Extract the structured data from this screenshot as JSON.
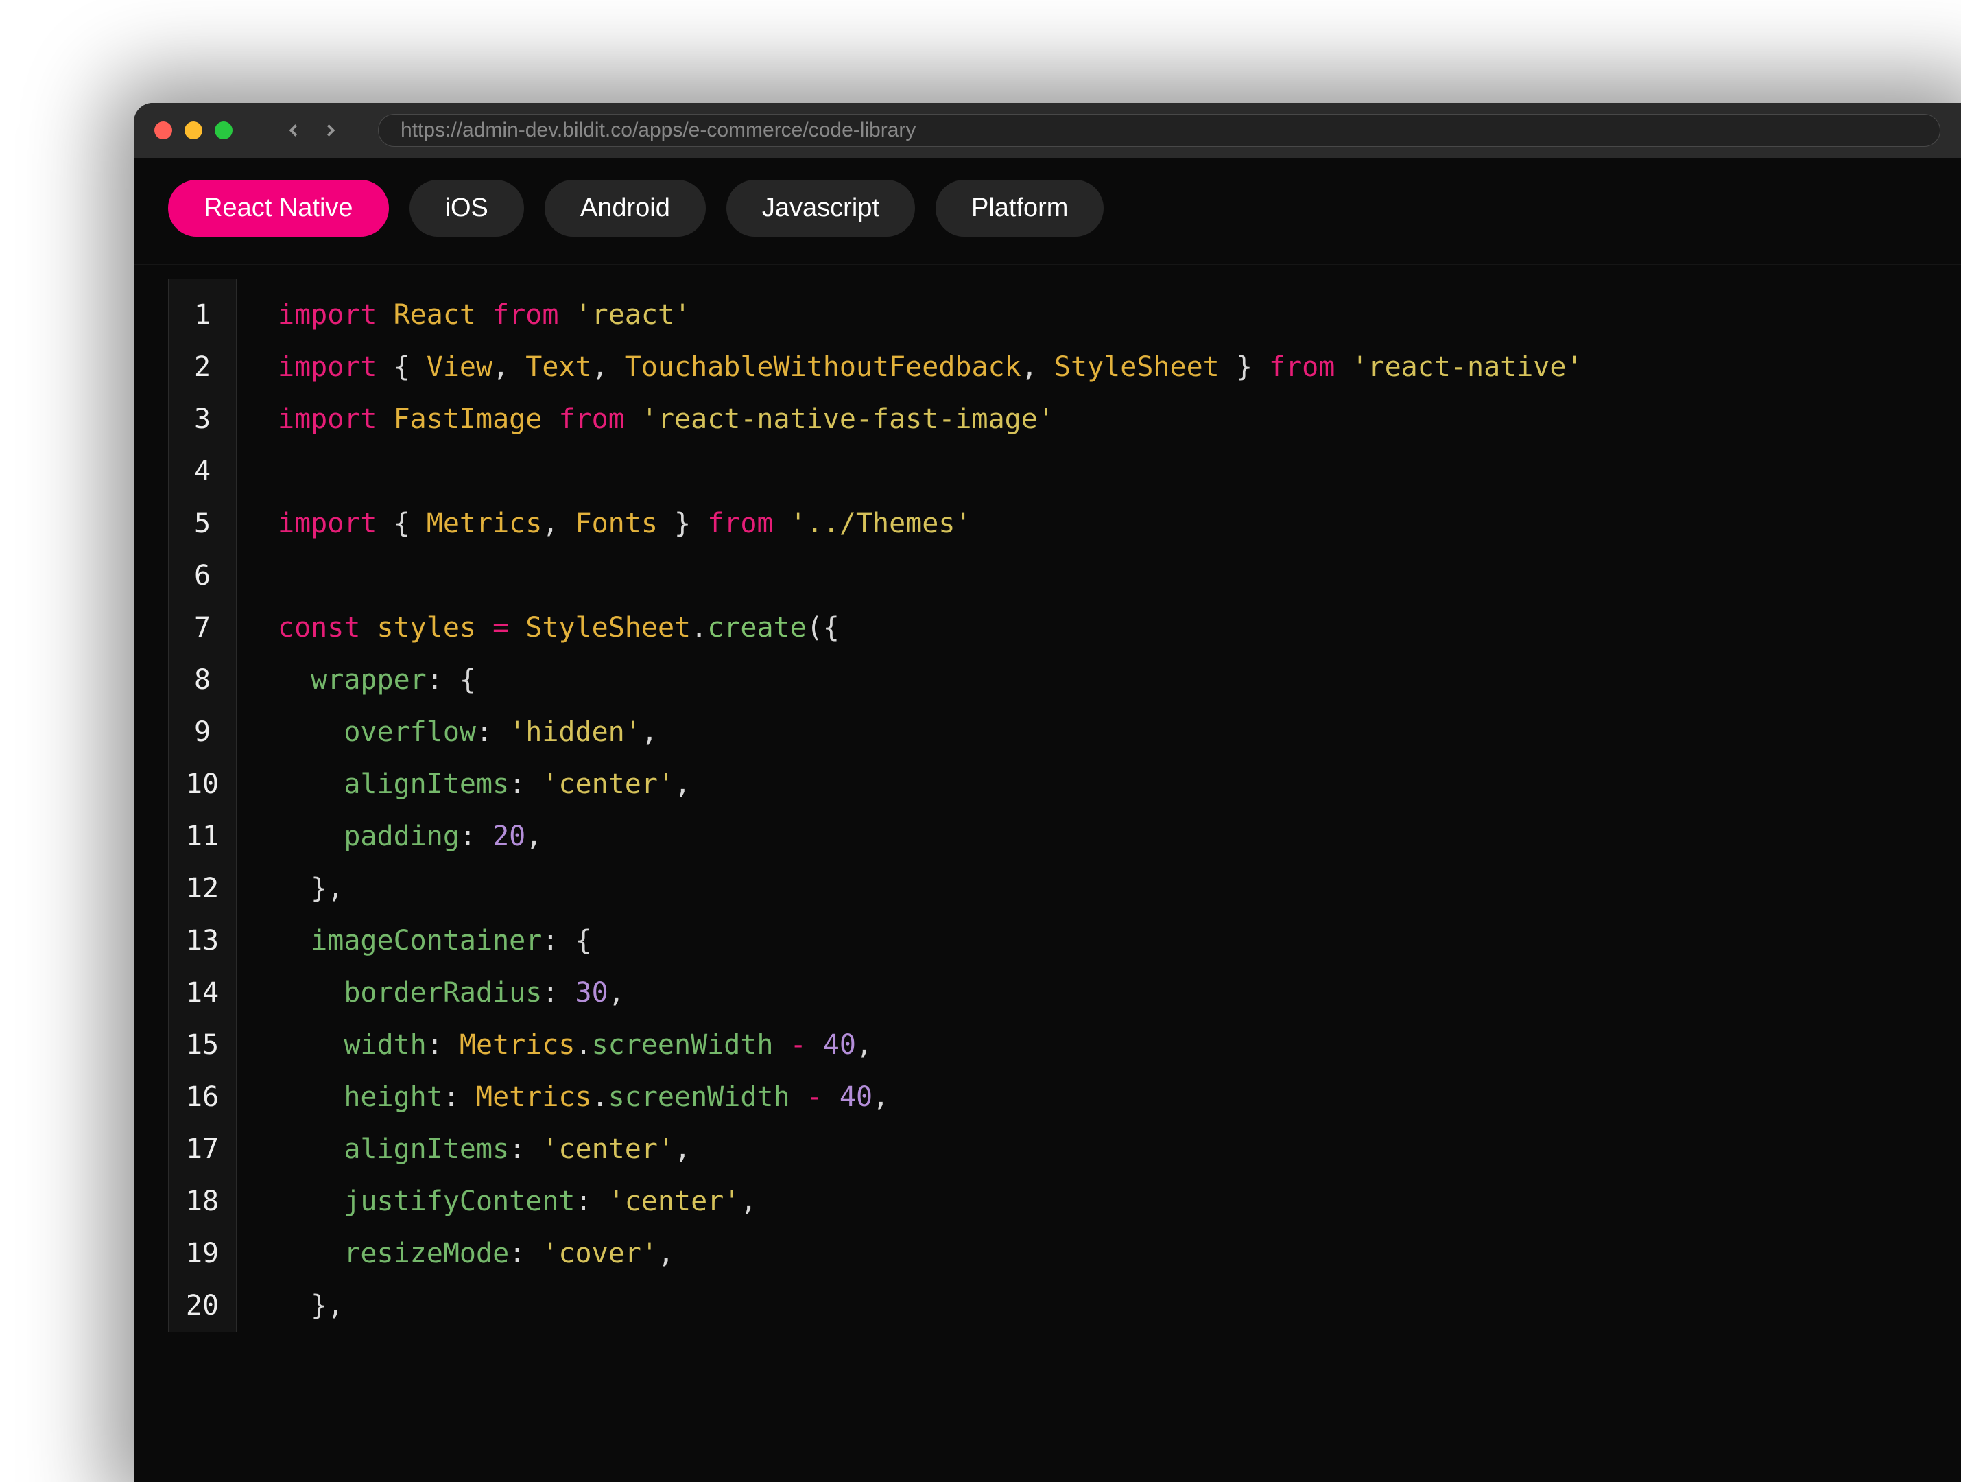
{
  "window": {
    "url": "https://admin-dev.bildit.co/apps/e-commerce/code-library"
  },
  "tabs": [
    {
      "label": "React Native",
      "active": true
    },
    {
      "label": "iOS",
      "active": false
    },
    {
      "label": "Android",
      "active": false
    },
    {
      "label": "Javascript",
      "active": false
    },
    {
      "label": "Platform",
      "active": false
    }
  ],
  "code": {
    "lineNumbers": [
      "1",
      "2",
      "3",
      "4",
      "5",
      "6",
      "7",
      "8",
      "9",
      "10",
      "11",
      "12",
      "13",
      "14",
      "15",
      "16",
      "17",
      "18",
      "19",
      "20"
    ],
    "lines": [
      [
        [
          "kw",
          "import"
        ],
        [
          "",
          ", "
        ],
        [
          "id",
          "React"
        ],
        [
          "",
          ", "
        ],
        [
          "kw",
          "from"
        ],
        [
          "",
          ", "
        ],
        [
          "str",
          "'react'"
        ]
      ],
      [
        [
          "kw",
          "import"
        ],
        [
          "",
          ", "
        ],
        [
          "punc",
          "{ "
        ],
        [
          "id",
          "View"
        ],
        [
          "punc",
          ", "
        ],
        [
          "id",
          "Text"
        ],
        [
          "punc",
          ", "
        ],
        [
          "id",
          "TouchableWithoutFeedback"
        ],
        [
          "punc",
          ", "
        ],
        [
          "id",
          "StyleSheet"
        ],
        [
          "punc",
          " } "
        ],
        [
          "kw",
          "from"
        ],
        [
          "",
          ", "
        ],
        [
          "str",
          "'react-native'"
        ]
      ],
      [
        [
          "kw",
          "import"
        ],
        [
          "",
          ", "
        ],
        [
          "id",
          "FastImage"
        ],
        [
          "",
          ", "
        ],
        [
          "kw",
          "from"
        ],
        [
          "",
          ", "
        ],
        [
          "str",
          "'react-native-fast-image'"
        ]
      ],
      [],
      [
        [
          "kw",
          "import"
        ],
        [
          "",
          ", "
        ],
        [
          "punc",
          "{ "
        ],
        [
          "id",
          "Metrics"
        ],
        [
          "punc",
          ", "
        ],
        [
          "id",
          "Fonts"
        ],
        [
          "punc",
          " } "
        ],
        [
          "kw",
          "from"
        ],
        [
          "",
          ", "
        ],
        [
          "str",
          "'../Themes'"
        ]
      ],
      [],
      [
        [
          "kw",
          "const"
        ],
        [
          "",
          ", "
        ],
        [
          "id",
          "styles"
        ],
        [
          "",
          ", "
        ],
        [
          "op",
          "="
        ],
        [
          "",
          ", "
        ],
        [
          "id",
          "StyleSheet"
        ],
        [
          "dot",
          "."
        ],
        [
          "fn",
          "create"
        ],
        [
          "punc",
          "({"
        ]
      ],
      [
        [
          "",
          "  "
        ],
        [
          "prop",
          "wrapper"
        ],
        [
          "punc",
          ": {"
        ]
      ],
      [
        [
          "",
          "    "
        ],
        [
          "prop",
          "overflow"
        ],
        [
          "punc",
          ": "
        ],
        [
          "str",
          "'hidden'"
        ],
        [
          "punc",
          ","
        ]
      ],
      [
        [
          "",
          "    "
        ],
        [
          "prop",
          "alignItems"
        ],
        [
          "punc",
          ": "
        ],
        [
          "str",
          "'center'"
        ],
        [
          "punc",
          ","
        ]
      ],
      [
        [
          "",
          "    "
        ],
        [
          "prop",
          "padding"
        ],
        [
          "punc",
          ": "
        ],
        [
          "num",
          "20"
        ],
        [
          "punc",
          ","
        ]
      ],
      [
        [
          "",
          "  "
        ],
        [
          "punc",
          "},"
        ]
      ],
      [
        [
          "",
          "  "
        ],
        [
          "prop",
          "imageContainer"
        ],
        [
          "punc",
          ": {"
        ]
      ],
      [
        [
          "",
          "    "
        ],
        [
          "prop",
          "borderRadius"
        ],
        [
          "punc",
          ": "
        ],
        [
          "num",
          "30"
        ],
        [
          "punc",
          ","
        ]
      ],
      [
        [
          "",
          "    "
        ],
        [
          "prop",
          "width"
        ],
        [
          "punc",
          ": "
        ],
        [
          "id",
          "Metrics"
        ],
        [
          "dot",
          "."
        ],
        [
          "prop",
          "screenWidth"
        ],
        [
          "",
          ", "
        ],
        [
          "op",
          "-"
        ],
        [
          "",
          ", "
        ],
        [
          "num",
          "40"
        ],
        [
          "punc",
          ","
        ]
      ],
      [
        [
          "",
          "    "
        ],
        [
          "prop",
          "height"
        ],
        [
          "punc",
          ": "
        ],
        [
          "id",
          "Metrics"
        ],
        [
          "dot",
          "."
        ],
        [
          "prop",
          "screenWidth"
        ],
        [
          "",
          ", "
        ],
        [
          "op",
          "-"
        ],
        [
          "",
          ", "
        ],
        [
          "num",
          "40"
        ],
        [
          "punc",
          ","
        ]
      ],
      [
        [
          "",
          "    "
        ],
        [
          "prop",
          "alignItems"
        ],
        [
          "punc",
          ": "
        ],
        [
          "str",
          "'center'"
        ],
        [
          "punc",
          ","
        ]
      ],
      [
        [
          "",
          "    "
        ],
        [
          "prop",
          "justifyContent"
        ],
        [
          "punc",
          ": "
        ],
        [
          "str",
          "'center'"
        ],
        [
          "punc",
          ","
        ]
      ],
      [
        [
          "",
          "    "
        ],
        [
          "prop",
          "resizeMode"
        ],
        [
          "punc",
          ": "
        ],
        [
          "str",
          "'cover'"
        ],
        [
          "punc",
          ","
        ]
      ],
      [
        [
          "",
          "  "
        ],
        [
          "punc",
          "},"
        ]
      ]
    ]
  }
}
